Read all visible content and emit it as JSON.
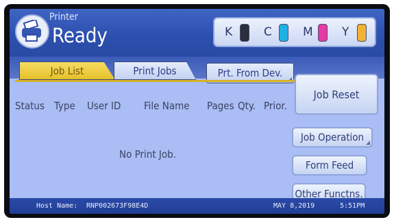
{
  "header": {
    "app_title": "Printer",
    "status": "Ready"
  },
  "inks": [
    {
      "letter": "K",
      "color": "#2b2f3b",
      "icon": "ink-cartridge-icon"
    },
    {
      "letter": "C",
      "color": "#1fb0e6",
      "icon": "ink-cartridge-icon"
    },
    {
      "letter": "M",
      "color": "#e63aa4",
      "icon": "ink-cartridge-icon"
    },
    {
      "letter": "Y",
      "color": "#f2b233",
      "icon": "ink-cartridge-icon"
    }
  ],
  "tabs": [
    {
      "label": "Job List",
      "active": true
    },
    {
      "label": "Print Jobs",
      "active": false
    },
    {
      "label": "Prt. From Dev.",
      "active": false
    }
  ],
  "columns": [
    "Status",
    "Type",
    "User ID",
    "File Name",
    "Pages",
    "Qty.",
    "Prior."
  ],
  "empty_message": "No Print Job.",
  "buttons": {
    "job_reset": "Job Reset",
    "job_operation": "Job Operation",
    "form_feed": "Form Feed",
    "other_functions": "Other Functns."
  },
  "footer": {
    "host_label": "Host Name:",
    "host_value": "RNP002673F98E4D",
    "date": "MAY   8,2019",
    "time": "5:51PM"
  }
}
